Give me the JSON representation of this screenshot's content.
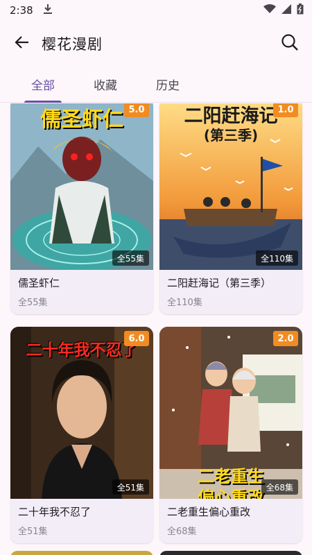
{
  "status_bar": {
    "time": "2:38"
  },
  "app_bar": {
    "title": "樱花漫剧"
  },
  "tabs": [
    {
      "label": "全部",
      "active": true
    },
    {
      "label": "收藏",
      "active": false
    },
    {
      "label": "历史",
      "active": false
    }
  ],
  "dramas": [
    {
      "poster_text": "儒圣虾仁",
      "rating": "5.0",
      "episodes_badge": "全55集",
      "title": "儒圣虾仁",
      "episodes": "全55集"
    },
    {
      "poster_text": "二阳赶海记",
      "poster_subtext": "(第三季)",
      "rating": "1.0",
      "episodes_badge": "全110集",
      "title": "二阳赶海记（第三季）",
      "episodes": "全110集"
    },
    {
      "poster_text": "二十年我不忍了",
      "rating": "6.0",
      "episodes_badge": "全51集",
      "title": "二十年我不忍了",
      "episodes": "全51集"
    },
    {
      "poster_text": "二老重生",
      "poster_subtext": "偏心重改",
      "rating": "2.0",
      "episodes_badge": "全68集",
      "title": "二老重生偏心重改",
      "episodes": "全68集"
    }
  ],
  "colors": {
    "accent": "#6750a4",
    "rating_badge": "#f28c22",
    "background": "#fdf7fb"
  }
}
